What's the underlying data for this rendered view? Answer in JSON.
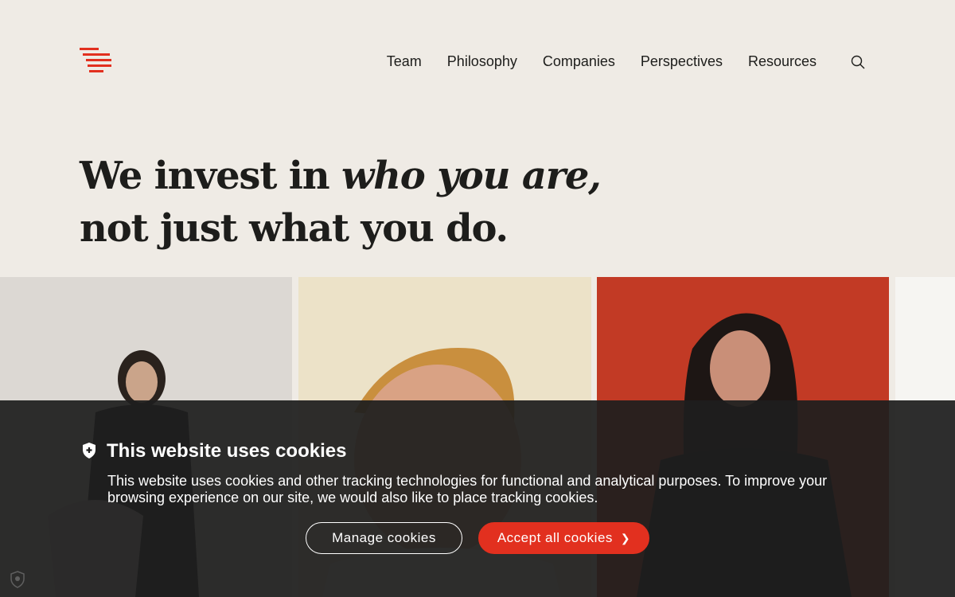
{
  "header": {
    "logo_icon": "stacked-lines-logo",
    "nav": [
      "Team",
      "Philosophy",
      "Companies",
      "Perspectives",
      "Resources"
    ],
    "search_icon": "search-icon"
  },
  "hero": {
    "line1_plain": "We invest in ",
    "line1_italic": "who you are,",
    "line2": "not just what you do."
  },
  "cookie_banner": {
    "title": "This website uses cookies",
    "text": "This website uses cookies and other tracking technologies for functional and analytical purposes. To improve your browsing experience on our site, we would also like to place tracking cookies.",
    "manage_label": "Manage cookies",
    "accept_label": "Accept all cookies",
    "accept_icon": "chevron-right-icon"
  },
  "colors": {
    "accent": "#e2301f",
    "background": "#efebe5",
    "banner": "#1e1e1e"
  }
}
